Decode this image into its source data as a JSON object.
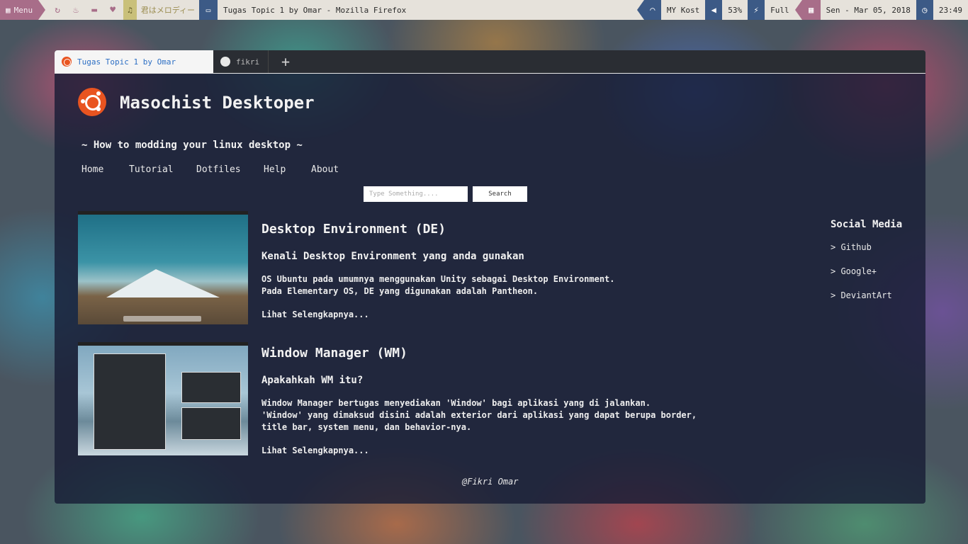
{
  "panel": {
    "menu_label": "Menu",
    "music_text": "君はメロディー",
    "window_title": "Tugas Topic 1 by Omar - Mozilla Firefox",
    "wifi_label": "MY Kost",
    "volume_label": "53%",
    "battery_label": "Full",
    "date_label": "Sen - Mar 05, 2018",
    "time_label": "23:49"
  },
  "browser": {
    "tabs": [
      {
        "label": "Tugas Topic 1 by Omar",
        "active": true
      },
      {
        "label": "fikri",
        "active": false
      }
    ],
    "new_tab_symbol": "+"
  },
  "site": {
    "title": "Masochist Desktoper",
    "tagline": "~ How to modding your linux desktop ~",
    "nav": [
      "Home",
      "Tutorial",
      "Dotfiles",
      "Help",
      "About"
    ],
    "search_placeholder": "Type Something....",
    "search_button": "Search",
    "posts": [
      {
        "title": "Desktop Environment (DE)",
        "subtitle": "Kenali Desktop Environment yang anda gunakan",
        "lines": [
          "OS Ubuntu pada umumnya menggunakan Unity sebagai Desktop Environment.",
          "Pada Elementary OS, DE yang digunakan adalah Pantheon."
        ],
        "more": "Lihat Selengkapnya..."
      },
      {
        "title": "Window Manager (WM)",
        "subtitle": "Apakahkah WM itu?",
        "lines": [
          "Window Manager bertugas menyediakan 'Window' bagi aplikasi yang di jalankan.",
          "'Window' yang dimaksud disini adalah exterior dari aplikasi yang dapat berupa border,",
          "title bar, system menu, dan behavior-nya."
        ],
        "more": "Lihat Selengkapnya..."
      }
    ],
    "social": {
      "title": "Social Media",
      "links": [
        "> Github",
        "> Google+",
        "> DeviantArt"
      ]
    },
    "footer": "@Fikri Omar"
  }
}
